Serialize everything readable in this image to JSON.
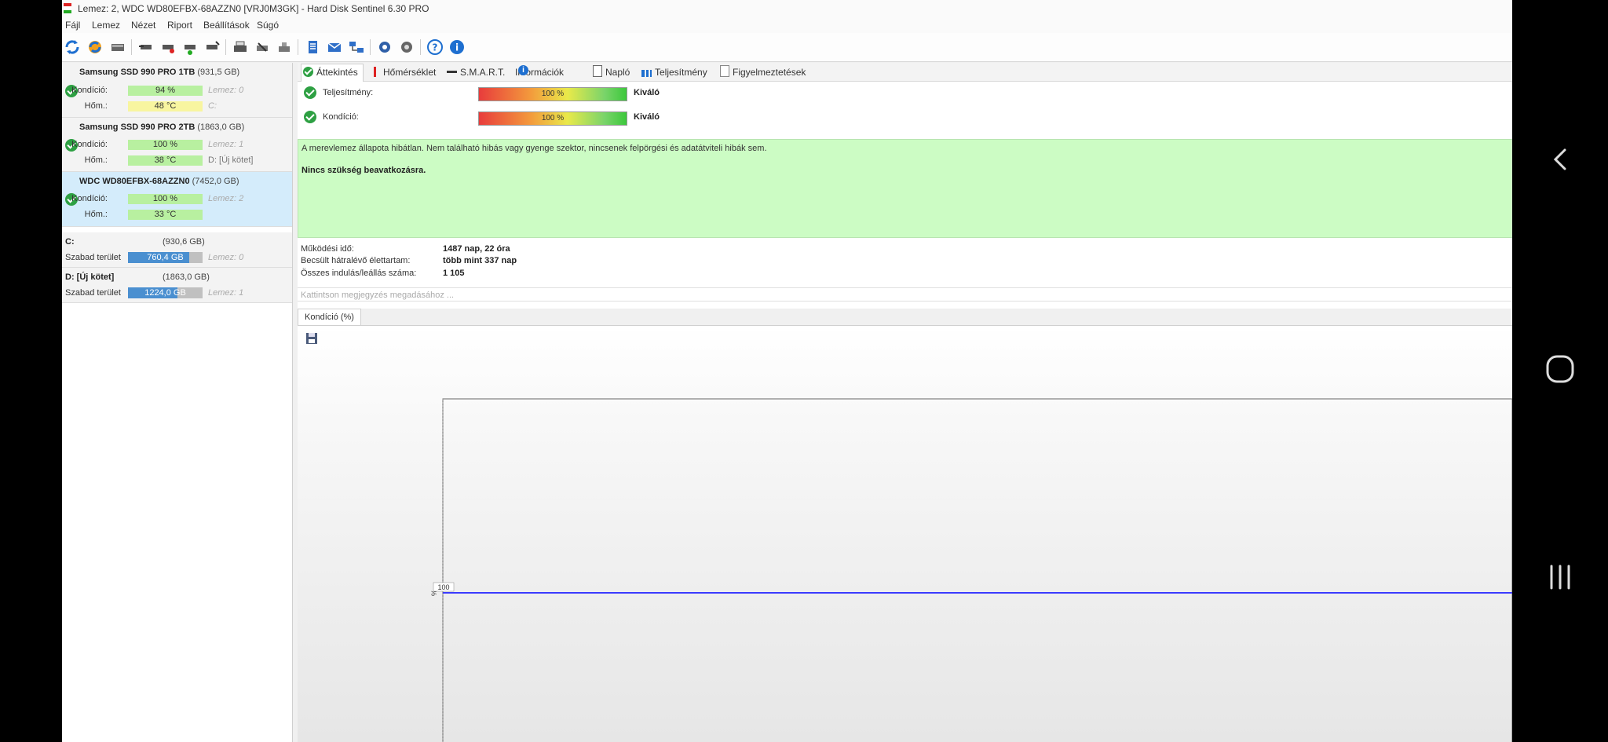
{
  "window": {
    "title": "Lemez: 2, WDC WD80EFBX-68AZZN0 [VRJ0M3GK]  -  Hard Disk Sentinel 6.30 PRO"
  },
  "menu": [
    "Fájl",
    "Lemez",
    "Nézet",
    "Riport",
    "Beállítások",
    "Súgó"
  ],
  "toolbar_icons": [
    "refresh-icon",
    "refresh-all-icon",
    "disk-icon",
    "tool-1-icon",
    "tool-2-icon",
    "tool-3-icon",
    "tool-4-icon",
    "print-icon",
    "tool-5-icon",
    "tool-6-icon",
    "report-icon",
    "mail-icon",
    "network-icon",
    "settings-icon",
    "settings-2-icon",
    "help-icon",
    "info-icon"
  ],
  "disks": [
    {
      "name": "Samsung SSD 990 PRO 1TB",
      "capacity": "(931,5 GB)",
      "condition_label": "Kondíció:",
      "condition": "94 %",
      "disk_ref": "Lemez: 0",
      "temp_label": "Hőm.:",
      "temp": "48 °C",
      "temp_color": "yellow",
      "volumes": "C:",
      "condition_fraction": 0.94
    },
    {
      "name": "Samsung SSD 990 PRO 2TB",
      "capacity": "(1863,0 GB)",
      "condition_label": "Kondíció:",
      "condition": "100 %",
      "disk_ref": "Lemez: 1",
      "temp_label": "Hőm.:",
      "temp": "38 °C",
      "temp_color": "green",
      "volumes": "D: [Új kötet]",
      "condition_fraction": 1.0
    },
    {
      "name": "WDC WD80EFBX-68AZZN0",
      "capacity": "(7452,0 GB)",
      "condition_label": "Kondíció:",
      "condition": "100 %",
      "disk_ref": "Lemez: 2",
      "temp_label": "Hőm.:",
      "temp": "33 °C",
      "temp_color": "green",
      "volumes": "",
      "condition_fraction": 1.0
    }
  ],
  "volumes": [
    {
      "name": "C:",
      "size": "(930,6 GB)",
      "free_label": "Szabad terület",
      "free": "760,4 GB",
      "disk_ref": "Lemez: 0",
      "free_fraction": 0.82
    },
    {
      "name": "D: [Új kötet]",
      "size": "(1863,0 GB)",
      "free_label": "Szabad terület",
      "free": "1224,0 GB",
      "disk_ref": "Lemez: 1",
      "free_fraction": 0.66
    }
  ],
  "tabs": [
    "Áttekintés",
    "Hőmérséklet",
    "S.M.A.R.T.",
    "Információk",
    "Napló",
    "Teljesítmény",
    "Figyelmeztetések"
  ],
  "metrics": [
    {
      "label": "Teljesítmény:",
      "value": "100 %",
      "rating": "Kiváló"
    },
    {
      "label": "Kondíció:",
      "value": "100 %",
      "rating": "Kiváló"
    }
  ],
  "status": {
    "text": "A merevlemez állapota hibátlan. Nem található hibás vagy gyenge szektor, nincsenek felpörgési és adatátviteli hibák sem.",
    "advice": "Nincs szükség beavatkozásra."
  },
  "info_rows": [
    {
      "label": "Működési idő:",
      "value": "1487 nap, 22 óra"
    },
    {
      "label": "Becsült hátralévő élettartam:",
      "value": "több mint 337 nap"
    },
    {
      "label": "Összes indulás/leállás száma:",
      "value": "1 105"
    }
  ],
  "note_placeholder": "Kattintson megjegyzés megadásához ...",
  "chart_tab": "Kondíció  (%)",
  "chart_data": {
    "type": "line",
    "title": "",
    "xlabel": "",
    "ylabel": "%",
    "series": [
      {
        "values": [
          100,
          100
        ]
      }
    ],
    "value_label": "100",
    "line_color": "#3b3bff"
  },
  "colors": {
    "status_bg": "#ccfcc4",
    "ok_green": "#2ea043",
    "selection": "#d4ecfb",
    "volume_bar": "#4a8fd0"
  }
}
